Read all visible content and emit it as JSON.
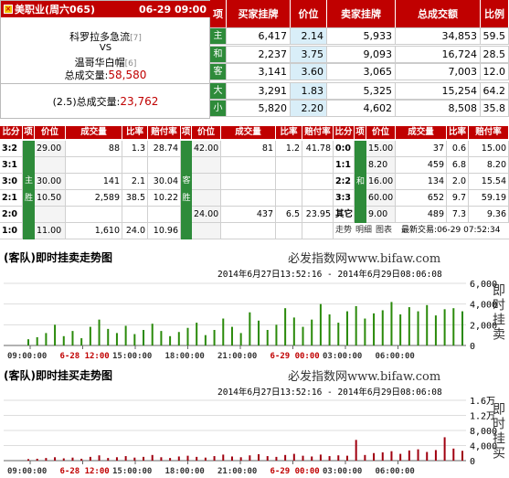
{
  "match": {
    "league": "美职业(周六065)",
    "datetime": "06-29 09:00",
    "home": "科罗拉多急流",
    "home_rank": "[7]",
    "vs": "VS",
    "away": "温哥华白帽",
    "away_rank": "[6]",
    "total_label": "总成交量:",
    "total_value": "58,580",
    "handicap_total_label": "(2.5)总成交量:",
    "handicap_total_value": "23,762"
  },
  "top_table": {
    "headers": [
      "项",
      "买家挂牌",
      "价位",
      "卖家挂牌",
      "总成交额",
      "比例"
    ],
    "rows": [
      {
        "item": "主",
        "buy": "6,417",
        "price": "2.14",
        "sell": "5,933",
        "total": "34,853",
        "ratio": "59.5"
      },
      {
        "item": "和",
        "buy": "2,237",
        "price": "3.75",
        "sell": "9,093",
        "total": "16,724",
        "ratio": "28.5"
      },
      {
        "item": "客",
        "buy": "3,141",
        "price": "3.60",
        "sell": "3,065",
        "total": "7,003",
        "ratio": "12.0"
      },
      {
        "item": "大",
        "buy": "3,291",
        "price": "1.83",
        "sell": "5,325",
        "total": "15,254",
        "ratio": "64.2"
      },
      {
        "item": "小",
        "buy": "5,820",
        "price": "2.20",
        "sell": "4,602",
        "total": "8,508",
        "ratio": "35.8"
      }
    ]
  },
  "score_table": {
    "headers_left": [
      "比分",
      "项",
      "价位",
      "成交量",
      "比率",
      "赔付率"
    ],
    "headers_mid": [
      "项",
      "价位",
      "成交量",
      "比率",
      "赔付率"
    ],
    "headers_right": [
      "比分",
      "项",
      "价位",
      "成交量",
      "比率",
      "赔付率"
    ],
    "left_item_labels": {
      "top": "主",
      "bottom": "胜"
    },
    "mid_item_labels": {
      "top": "客",
      "bottom": "胜"
    },
    "right_item_label": "和",
    "left": [
      {
        "score": "3:2",
        "price": "29.00",
        "vol": "88",
        "ratio": "1.3",
        "pay": "28.74"
      },
      {
        "score": "3:1",
        "price": "",
        "vol": "",
        "ratio": "",
        "pay": ""
      },
      {
        "score": "3:0",
        "price": "30.00",
        "vol": "141",
        "ratio": "2.1",
        "pay": "30.04"
      },
      {
        "score": "2:1",
        "price": "10.50",
        "vol": "2,589",
        "ratio": "38.5",
        "pay": "10.22"
      },
      {
        "score": "2:0",
        "price": "",
        "vol": "",
        "ratio": "",
        "pay": ""
      },
      {
        "score": "1:0",
        "price": "11.00",
        "vol": "1,610",
        "ratio": "24.0",
        "pay": "10.96"
      }
    ],
    "mid": [
      {
        "price": "42.00",
        "vol": "81",
        "ratio": "1.2",
        "pay": "41.78"
      },
      {
        "price": "",
        "vol": "",
        "ratio": "",
        "pay": ""
      },
      {
        "price": "",
        "vol": "",
        "ratio": "",
        "pay": ""
      },
      {
        "price": "",
        "vol": "",
        "ratio": "",
        "pay": ""
      },
      {
        "price": "24.00",
        "vol": "437",
        "ratio": "6.5",
        "pay": "23.95"
      },
      {
        "price": "",
        "vol": "",
        "ratio": "",
        "pay": ""
      }
    ],
    "right": [
      {
        "score": "0:0",
        "item": "",
        "price": "15.00",
        "vol": "37",
        "ratio": "0.6",
        "pay": "15.00"
      },
      {
        "score": "1:1",
        "item": "和",
        "price": "8.20",
        "vol": "459",
        "ratio": "6.8",
        "pay": "8.20"
      },
      {
        "score": "2:2",
        "item": "局",
        "price": "16.00",
        "vol": "134",
        "ratio": "2.0",
        "pay": "15.54"
      },
      {
        "score": "3:3",
        "item": "",
        "price": "60.00",
        "vol": "652",
        "ratio": "9.7",
        "pay": "59.19"
      },
      {
        "score": "其它",
        "item": "",
        "price": "9.00",
        "vol": "489",
        "ratio": "7.3",
        "pay": "9.36"
      }
    ],
    "footer_links": [
      "走势",
      "明细",
      "图表"
    ],
    "last_trade": "最新交易:06-29 07:52:34"
  },
  "chart1": {
    "title": "(客队)即时挂卖走势图",
    "brand": "必发指数网www.bifaw.com",
    "range": "2014年6月27日13:52:16 - 2014年6月29日08:06:08",
    "vlabel": "即时挂卖",
    "yticks": [
      "6,000",
      "4,000",
      "2,000",
      "0"
    ],
    "xticks": [
      "09:00:00",
      "6-28 12:00",
      "15:00:00",
      "18:00:00",
      "21:00:00",
      "6-29 00:00",
      "03:00:00",
      "06:00:00"
    ],
    "red_ticks": [
      1,
      5
    ],
    "color": "#2a8a0a"
  },
  "chart2": {
    "title": "(客队)即时挂买走势图",
    "brand": "必发指数网www.bifaw.com",
    "range": "2014年6月27日13:52:16 - 2014年6月29日08:06:08",
    "vlabel": "即时挂买",
    "yticks": [
      "1.6万",
      "1.2万",
      "8,000",
      "4,000",
      "0"
    ],
    "xticks": [
      "09:00:00",
      "6-28 12:00",
      "15:00:00",
      "18:00:00",
      "21:00:00",
      "6-29 00:00",
      "03:00:00",
      "06:00:00"
    ],
    "red_ticks": [
      1,
      5
    ],
    "color": "#a00010"
  },
  "chart_data": [
    {
      "type": "bar",
      "title": "(客队)即时挂卖走势图",
      "ylabel": "即时挂卖",
      "ylim": [
        0,
        6000
      ],
      "values": [
        600,
        800,
        1200,
        2000,
        900,
        1400,
        700,
        1800,
        2500,
        1600,
        1200,
        1900,
        1100,
        1500,
        2100,
        1400,
        900,
        1300,
        1700,
        2200,
        1000,
        1500,
        2600,
        1800,
        1200,
        3200,
        2400,
        1500,
        2000,
        3600,
        2700,
        1800,
        2500,
        4000,
        3000,
        2200,
        3300,
        3800,
        2600,
        3100,
        3400,
        4200,
        3000,
        3700,
        3300,
        3900,
        2900,
        3500,
        3600,
        3300
      ]
    },
    {
      "type": "bar",
      "title": "(客队)即时挂买走势图",
      "ylabel": "即时挂买",
      "ylim": [
        0,
        16000
      ],
      "values": [
        400,
        500,
        700,
        900,
        600,
        800,
        500,
        1000,
        1400,
        700,
        900,
        1200,
        800,
        1000,
        1500,
        900,
        700,
        1100,
        1300,
        1000,
        800,
        1200,
        1600,
        1100,
        900,
        1400,
        1700,
        1200,
        1000,
        1500,
        1800,
        1300,
        1100,
        1600,
        1200,
        1400,
        1300,
        5500,
        1500,
        2000,
        2200,
        2500,
        1800,
        2700,
        3000,
        2300,
        2800,
        6200,
        3200,
        2600
      ]
    }
  ]
}
